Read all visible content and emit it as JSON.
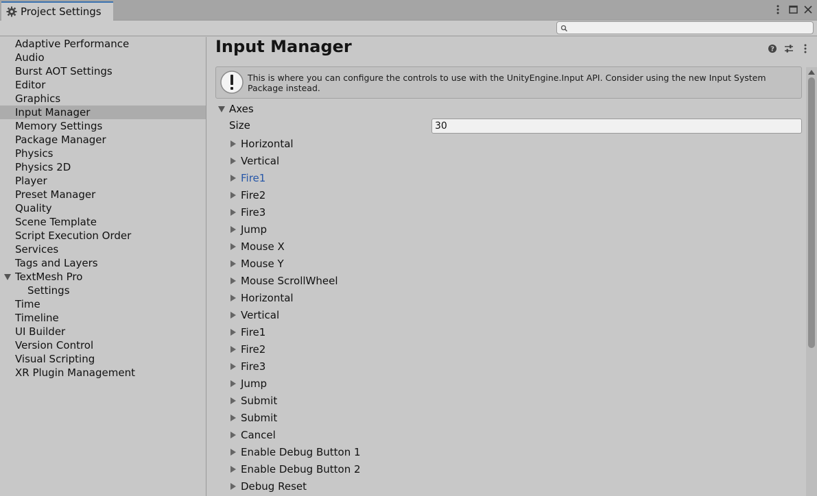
{
  "window": {
    "tab_title": "Project Settings",
    "tab_icon": "gear-icon"
  },
  "search": {
    "placeholder": ""
  },
  "sidebar": {
    "items": [
      {
        "label": "Adaptive Performance"
      },
      {
        "label": "Audio"
      },
      {
        "label": "Burst AOT Settings"
      },
      {
        "label": "Editor"
      },
      {
        "label": "Graphics"
      },
      {
        "label": "Input Manager",
        "selected": true
      },
      {
        "label": "Memory Settings"
      },
      {
        "label": "Package Manager"
      },
      {
        "label": "Physics"
      },
      {
        "label": "Physics 2D"
      },
      {
        "label": "Player"
      },
      {
        "label": "Preset Manager"
      },
      {
        "label": "Quality"
      },
      {
        "label": "Scene Template"
      },
      {
        "label": "Script Execution Order"
      },
      {
        "label": "Services"
      },
      {
        "label": "Tags and Layers"
      },
      {
        "label": "TextMesh Pro",
        "expanded": true
      },
      {
        "label": "Settings",
        "child": true
      },
      {
        "label": "Time"
      },
      {
        "label": "Timeline"
      },
      {
        "label": "UI Builder"
      },
      {
        "label": "Version Control"
      },
      {
        "label": "Visual Scripting"
      },
      {
        "label": "XR Plugin Management"
      }
    ]
  },
  "main": {
    "title": "Input Manager",
    "notice": "This is where you can configure the controls to use with the UnityEngine.Input API. Consider using the new Input System Package instead.",
    "axes_label": "Axes",
    "size_label": "Size",
    "size_value": "30",
    "axes": [
      "Horizontal",
      "Vertical",
      "Fire1",
      "Fire2",
      "Fire3",
      "Jump",
      "Mouse X",
      "Mouse Y",
      "Mouse ScrollWheel",
      "Horizontal",
      "Vertical",
      "Fire1",
      "Fire2",
      "Fire3",
      "Jump",
      "Submit",
      "Submit",
      "Cancel",
      "Enable Debug Button 1",
      "Enable Debug Button 2",
      "Debug Reset"
    ],
    "highlighted_axis": 2
  },
  "colors": {
    "accent": "#3a72b0",
    "highlight_text": "#2757a8",
    "background": "#c8c8c8",
    "selected_row": "#acacac"
  }
}
